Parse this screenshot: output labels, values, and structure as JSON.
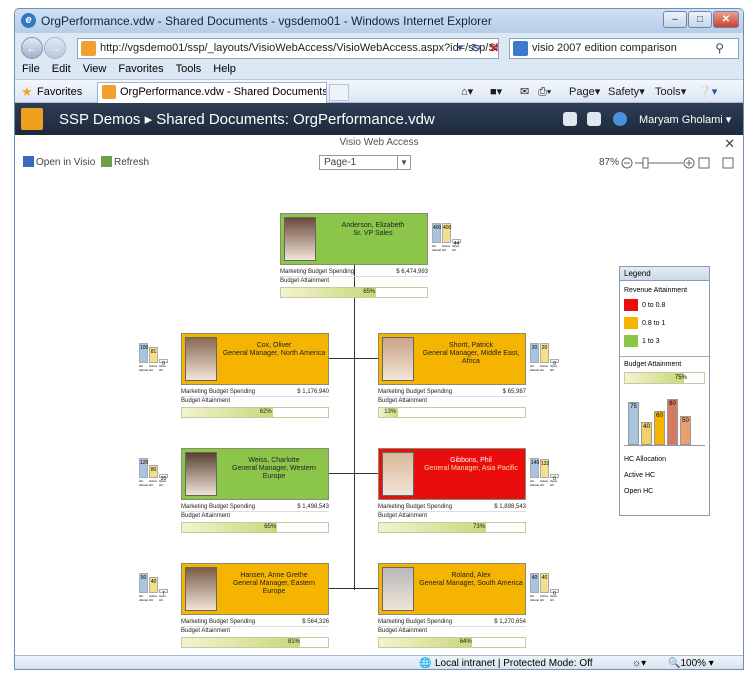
{
  "browser": {
    "window_title": "OrgPerformance.vdw - Shared Documents - vgsdemo01 - Windows Internet Explorer",
    "address": "http://vgsdemo01/ssp/_layouts/VisioWebAccess/VisioWebAccess.aspx?id=/ssp/Sha",
    "search_text": "visio 2007 edition comparison",
    "menu": [
      "File",
      "Edit",
      "View",
      "Favorites",
      "Tools",
      "Help"
    ],
    "favorites_label": "Favorites",
    "tab_title": "OrgPerformance.vdw - Shared Documents - vgsd...",
    "commands": {
      "page": "Page",
      "safety": "Safety",
      "tools": "Tools"
    },
    "status": "Local intranet | Protected Mode: Off",
    "zoom": "100%"
  },
  "sharepoint": {
    "breadcrumb": "SSP Demos  ▸  Shared Documents: OrgPerformance.vdw",
    "user": "Maryam Gholami"
  },
  "visio": {
    "header": "Visio Web Access",
    "open_in_visio": "Open in Visio",
    "refresh": "Refresh",
    "page_select": "Page-1",
    "zoom_level": "87%"
  },
  "metric_labels": {
    "spending": "Marketing Budget Spending",
    "attainment": "Budget Attainment"
  },
  "hc_labels": [
    "HC Allocation",
    "Active HC",
    "Open HC"
  ],
  "org": [
    {
      "id": "ceo",
      "name": "Anderson, Elizabeth",
      "title": "Sr. VP Sales",
      "color": "green",
      "spending": "$ 6,474,993",
      "attainment": "65%",
      "attainment_value": 0.65,
      "hc": [
        "400",
        "400",
        "44"
      ]
    },
    {
      "id": "cox",
      "name": "Cox, Oliver",
      "title": "General Manager, North America",
      "color": "orange",
      "spending": "$ 1,176,940",
      "attainment": "62%",
      "attainment_value": 0.62,
      "hc": [
        "100",
        "81",
        "0"
      ]
    },
    {
      "id": "shorts",
      "name": "Shortt, Patrick",
      "title": "General Manager, Middle East, Africa",
      "color": "orange",
      "spending": "$ 65,987",
      "attainment": "13%",
      "attainment_value": 0.13,
      "hc": [
        "20",
        "20",
        "0"
      ]
    },
    {
      "id": "weiss",
      "name": "Weiss, Charlotte",
      "title": "General Manager, Western Europe",
      "color": "green",
      "spending": "$ 1,498,543",
      "attainment": "65%",
      "attainment_value": 0.65,
      "hc": [
        "120",
        "80",
        "20"
      ]
    },
    {
      "id": "gibbons",
      "name": "Gibbons, Phil",
      "title": "General Manager, Asia Pacific",
      "color": "red",
      "spending": "$ 1,898,543",
      "attainment": "73%",
      "attainment_value": 0.73,
      "hc": [
        "140",
        "132",
        "0"
      ]
    },
    {
      "id": "hansen",
      "name": "Hansen, Anne Grethe",
      "title": "General Manager, Eastern Europe",
      "color": "orange",
      "spending": "$ 564,326",
      "attainment": "81%",
      "attainment_value": 0.81,
      "hc": [
        "50",
        "40",
        "7"
      ]
    },
    {
      "id": "roland",
      "name": "Roland, Alex",
      "title": "General Manager, South America",
      "color": "orange",
      "spending": "$ 1,270,654",
      "attainment": "64%",
      "attainment_value": 0.64,
      "hc": [
        "40",
        "40",
        "0"
      ]
    }
  ],
  "legend": {
    "title": "Legend",
    "revenue_title": "Revenue Attainment",
    "revenue_items": [
      {
        "label": "0 to 0.8",
        "color": "#ea0d0d"
      },
      {
        "label": "0.8 to 1",
        "color": "#f5b400"
      },
      {
        "label": "1 to 3",
        "color": "#8bc54a"
      }
    ],
    "budget_title": "Budget Attainment",
    "budget_value": "75%",
    "budget_fraction": 0.75,
    "hc_values": [
      "75",
      "40",
      "60",
      "80",
      "50"
    ],
    "hc_items": [
      "HC Allocation",
      "Active HC",
      "Open HC"
    ]
  }
}
